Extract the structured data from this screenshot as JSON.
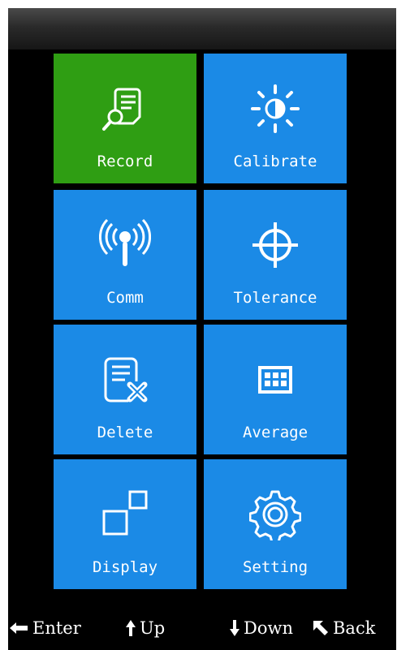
{
  "menu": {
    "tiles": [
      {
        "label": "Record",
        "icon": "record-search-icon",
        "selected": true
      },
      {
        "label": "Calibrate",
        "icon": "brightness-icon",
        "selected": false
      },
      {
        "label": "Comm",
        "icon": "wireless-signal-icon",
        "selected": false
      },
      {
        "label": "Tolerance",
        "icon": "crosshair-icon",
        "selected": false
      },
      {
        "label": "Delete",
        "icon": "delete-document-icon",
        "selected": false
      },
      {
        "label": "Average",
        "icon": "grid-icon",
        "selected": false
      },
      {
        "label": "Display",
        "icon": "display-squares-icon",
        "selected": false
      },
      {
        "label": "Setting",
        "icon": "gear-icon",
        "selected": false
      }
    ]
  },
  "footer": {
    "enter_label": "Enter",
    "up_label": "Up",
    "down_label": "Down",
    "back_label": "Back"
  },
  "colors": {
    "tile": "#1b8ae6",
    "tile_selected": "#2f9e13",
    "background": "#000000"
  }
}
